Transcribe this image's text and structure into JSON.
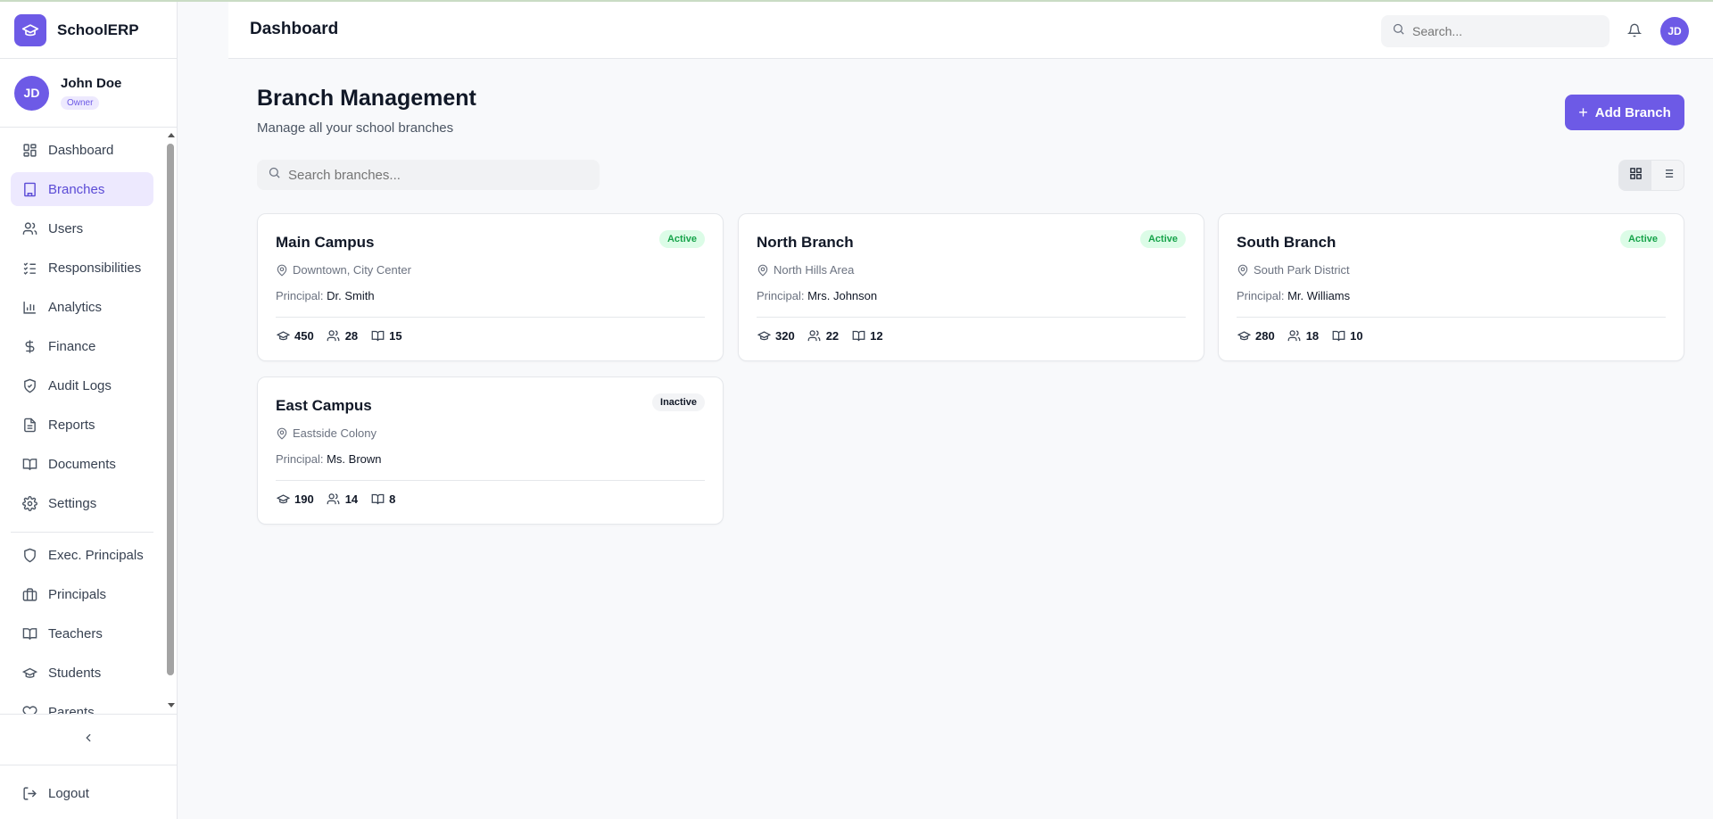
{
  "app": {
    "name": "SchoolERP"
  },
  "user": {
    "initials": "JD",
    "name": "John Doe",
    "role": "Owner"
  },
  "sidebar": {
    "items": [
      {
        "label": "Dashboard",
        "icon": "grid-icon"
      },
      {
        "label": "Branches",
        "icon": "building-icon",
        "active": true
      },
      {
        "label": "Users",
        "icon": "users-icon"
      },
      {
        "label": "Responsibilities",
        "icon": "list-check-icon"
      },
      {
        "label": "Analytics",
        "icon": "bar-chart-icon"
      },
      {
        "label": "Finance",
        "icon": "dollar-icon"
      },
      {
        "label": "Audit Logs",
        "icon": "shield-check-icon"
      },
      {
        "label": "Reports",
        "icon": "file-text-icon"
      },
      {
        "label": "Documents",
        "icon": "book-open-icon"
      },
      {
        "label": "Settings",
        "icon": "gear-icon"
      }
    ],
    "items2": [
      {
        "label": "Exec. Principals",
        "icon": "shield-icon"
      },
      {
        "label": "Principals",
        "icon": "briefcase-icon"
      },
      {
        "label": "Teachers",
        "icon": "book-open-icon"
      },
      {
        "label": "Students",
        "icon": "graduation-cap-icon"
      },
      {
        "label": "Parents",
        "icon": "heart-icon"
      }
    ],
    "logout": "Logout"
  },
  "header": {
    "title": "Dashboard",
    "search_placeholder": "Search...",
    "avatar": "JD"
  },
  "main": {
    "title": "Branch Management",
    "subtitle": "Manage all your school branches",
    "add_label": "Add Branch",
    "search_placeholder": "Search branches...",
    "principal_prefix": "Principal:",
    "branches": [
      {
        "name": "Main Campus",
        "status": "Active",
        "location": "Downtown, City Center",
        "principal": "Dr. Smith",
        "students": "450",
        "teachers": "28",
        "classes": "15"
      },
      {
        "name": "North Branch",
        "status": "Active",
        "location": "North Hills Area",
        "principal": "Mrs. Johnson",
        "students": "320",
        "teachers": "22",
        "classes": "12"
      },
      {
        "name": "South Branch",
        "status": "Active",
        "location": "South Park District",
        "principal": "Mr. Williams",
        "students": "280",
        "teachers": "18",
        "classes": "10"
      },
      {
        "name": "East Campus",
        "status": "Inactive",
        "location": "Eastside Colony",
        "principal": "Ms. Brown",
        "students": "190",
        "teachers": "14",
        "classes": "8"
      }
    ]
  },
  "colors": {
    "accent": "#6d5ae6",
    "active_bg": "#dcfce7",
    "active_text": "#16a34a"
  }
}
